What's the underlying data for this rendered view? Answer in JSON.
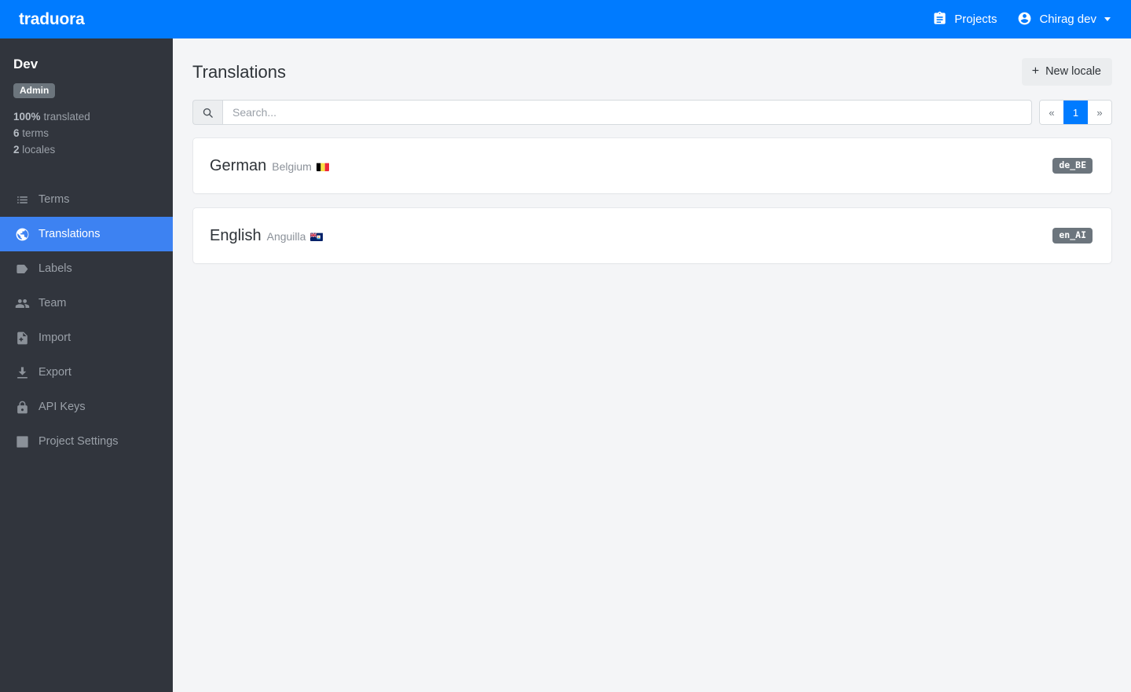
{
  "navbar": {
    "brand": "traduora",
    "projects_label": "Projects",
    "projects_icon": "clipboard-icon",
    "user_label": "Chirag dev",
    "user_icon": "account-circle-icon",
    "background_color": "#007bff"
  },
  "sidebar": {
    "project_name": "Dev",
    "role_badge": "Admin",
    "stats": {
      "translated_value": "100%",
      "translated_label": "translated",
      "terms_value": "6",
      "terms_label": "terms",
      "locales_value": "2",
      "locales_label": "locales"
    },
    "items": [
      {
        "label": "Terms",
        "icon": "list-icon",
        "active": false
      },
      {
        "label": "Translations",
        "icon": "globe-icon",
        "active": true
      },
      {
        "label": "Labels",
        "icon": "tag-icon",
        "active": false
      },
      {
        "label": "Team",
        "icon": "people-icon",
        "active": false
      },
      {
        "label": "Import",
        "icon": "file-plus-icon",
        "active": false
      },
      {
        "label": "Export",
        "icon": "download-icon",
        "active": false
      },
      {
        "label": "API Keys",
        "icon": "lock-icon",
        "active": false
      },
      {
        "label": "Project Settings",
        "icon": "gear-icon",
        "active": false
      }
    ],
    "active_color": "#3d82f2",
    "background_color": "#31353d"
  },
  "main": {
    "page_title": "Translations",
    "new_locale_label": "New locale",
    "new_locale_icon": "plus-icon",
    "search": {
      "placeholder": "Search...",
      "value": "",
      "icon": "search-icon"
    },
    "pagination": {
      "prev_label": "«",
      "next_label": "»",
      "current_page": "1"
    },
    "locales": [
      {
        "language": "German",
        "country": "Belgium",
        "code": "de_BE",
        "flag": "belgium-flag-icon"
      },
      {
        "language": "English",
        "country": "Anguilla",
        "code": "en_AI",
        "flag": "anguilla-flag-icon"
      }
    ]
  }
}
